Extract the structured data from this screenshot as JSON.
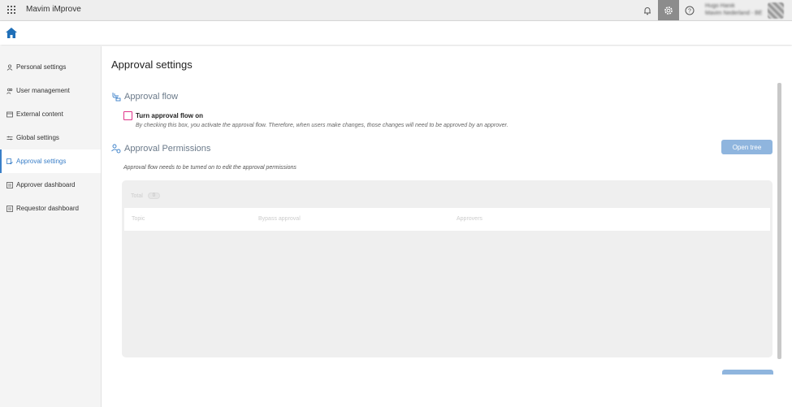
{
  "topbar": {
    "app_title": "Mavim iMprove",
    "user_name": "Hugo Hanik",
    "user_subtitle": "Mavim Nederland - BE",
    "icons": [
      "apps-grid-icon",
      "bell-icon",
      "gear-icon",
      "help-icon"
    ]
  },
  "sidebar": {
    "items": [
      {
        "label": "Personal settings",
        "icon": "person-icon"
      },
      {
        "label": "User management",
        "icon": "users-icon"
      },
      {
        "label": "External content",
        "icon": "external-icon"
      },
      {
        "label": "Global settings",
        "icon": "sliders-icon"
      },
      {
        "label": "Approval settings",
        "icon": "approval-icon",
        "active": true
      },
      {
        "label": "Approver dashboard",
        "icon": "dashboard-icon"
      },
      {
        "label": "Requestor dashboard",
        "icon": "dashboard-icon"
      }
    ]
  },
  "main": {
    "title": "Approval settings",
    "approval_flow": {
      "heading": "Approval flow",
      "checkbox_label": "Turn approval flow on",
      "checked": false,
      "description": "By checking this box, you activate the approval flow. Therefore, when users make changes, those changes will need to be approved by an approver."
    },
    "permissions": {
      "heading": "Approval Permissions",
      "open_tree_label": "Open tree",
      "note": "Approval flow needs to be turned on to edit the approval permissions",
      "total_label": "Total",
      "total_count": "0",
      "columns": [
        "Topic",
        "Bypass approval",
        "Approvers"
      ]
    }
  },
  "colors": {
    "accent": "#3a7fc8",
    "button": "#8fb5de",
    "checkbox_border": "#e0338a",
    "gear_active_bg": "#8c8c8c"
  }
}
